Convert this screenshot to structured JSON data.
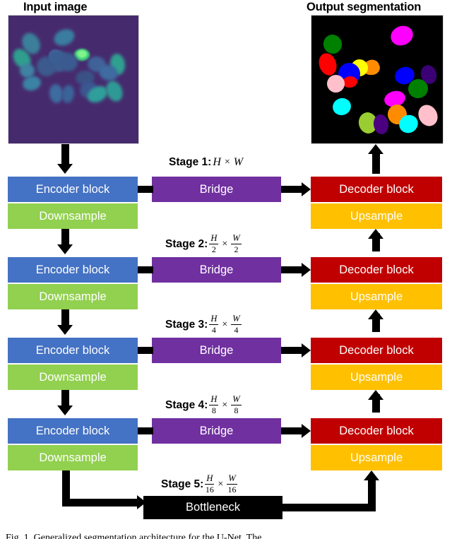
{
  "figure": {
    "panels": {
      "input": {
        "title": "Input image",
        "kind": "fluorescence-microscopy-nuclei"
      },
      "output": {
        "title": "Output segmentation",
        "kind": "instance-segmentation-mask"
      }
    },
    "caption": "Fig. 1. Generalized segmentation architecture for the U-Net. The",
    "colors": {
      "encoder": "#4472C4",
      "downsample": "#92D050",
      "bridge": "#7030A0",
      "decoder": "#C00000",
      "upsample": "#FFC000",
      "bottleneck": "#000000",
      "arrow": "#000000",
      "input_background": "#462A6E",
      "output_background": "#000000"
    },
    "labels": {
      "encoder": "Encoder block",
      "downsample": "Downsample",
      "bridge": "Bridge",
      "decoder": "Decoder block",
      "upsample": "Upsample",
      "bottleneck": "Bottleneck"
    },
    "stages": [
      {
        "name": "Stage 1:",
        "height_num": "H",
        "height_den": "",
        "width_num": "W",
        "width_den": "",
        "resolution": "H x W"
      },
      {
        "name": "Stage 2:",
        "height_num": "H",
        "height_den": "2",
        "width_num": "W",
        "width_den": "2",
        "resolution": "H/2 x W/2"
      },
      {
        "name": "Stage 3:",
        "height_num": "H",
        "height_den": "4",
        "width_num": "W",
        "width_den": "4",
        "resolution": "H/4 x W/4"
      },
      {
        "name": "Stage 4:",
        "height_num": "H",
        "height_den": "8",
        "width_num": "W",
        "width_den": "8",
        "resolution": "H/8 x W/8"
      },
      {
        "name": "Stage 5:",
        "height_num": "H",
        "height_den": "16",
        "width_num": "W",
        "width_den": "16",
        "resolution": "H/16 x W/16"
      }
    ],
    "times_symbol": "×"
  },
  "chart_data": {
    "type": "diagram",
    "title": "Generalized segmentation architecture for the U-Net",
    "nodes": [
      {
        "id": "input",
        "label": "Input image",
        "column": "left",
        "stage": 0,
        "color": "#462A6E"
      },
      {
        "id": "enc1",
        "label": "Encoder block",
        "column": "left",
        "stage": 1,
        "color": "#4472C4"
      },
      {
        "id": "down1",
        "label": "Downsample",
        "column": "left",
        "stage": 1,
        "color": "#92D050"
      },
      {
        "id": "enc2",
        "label": "Encoder block",
        "column": "left",
        "stage": 2,
        "color": "#4472C4"
      },
      {
        "id": "down2",
        "label": "Downsample",
        "column": "left",
        "stage": 2,
        "color": "#92D050"
      },
      {
        "id": "enc3",
        "label": "Encoder block",
        "column": "left",
        "stage": 3,
        "color": "#4472C4"
      },
      {
        "id": "down3",
        "label": "Downsample",
        "column": "left",
        "stage": 3,
        "color": "#92D050"
      },
      {
        "id": "enc4",
        "label": "Encoder block",
        "column": "left",
        "stage": 4,
        "color": "#4472C4"
      },
      {
        "id": "down4",
        "label": "Downsample",
        "column": "left",
        "stage": 4,
        "color": "#92D050"
      },
      {
        "id": "bridge1",
        "label": "Bridge",
        "column": "center",
        "stage": 1,
        "color": "#7030A0"
      },
      {
        "id": "bridge2",
        "label": "Bridge",
        "column": "center",
        "stage": 2,
        "color": "#7030A0"
      },
      {
        "id": "bridge3",
        "label": "Bridge",
        "column": "center",
        "stage": 3,
        "color": "#7030A0"
      },
      {
        "id": "bridge4",
        "label": "Bridge",
        "column": "center",
        "stage": 4,
        "color": "#7030A0"
      },
      {
        "id": "bottleneck",
        "label": "Bottleneck",
        "column": "center",
        "stage": 5,
        "color": "#000000"
      },
      {
        "id": "dec1",
        "label": "Decoder block",
        "column": "right",
        "stage": 1,
        "color": "#C00000"
      },
      {
        "id": "up1",
        "label": "Upsample",
        "column": "right",
        "stage": 1,
        "color": "#FFC000"
      },
      {
        "id": "dec2",
        "label": "Decoder block",
        "column": "right",
        "stage": 2,
        "color": "#C00000"
      },
      {
        "id": "up2",
        "label": "Upsample",
        "column": "right",
        "stage": 2,
        "color": "#FFC000"
      },
      {
        "id": "dec3",
        "label": "Decoder block",
        "column": "right",
        "stage": 3,
        "color": "#C00000"
      },
      {
        "id": "up3",
        "label": "Upsample",
        "column": "right",
        "stage": 3,
        "color": "#FFC000"
      },
      {
        "id": "dec4",
        "label": "Decoder block",
        "column": "right",
        "stage": 4,
        "color": "#C00000"
      },
      {
        "id": "up4",
        "label": "Upsample",
        "column": "right",
        "stage": 4,
        "color": "#FFC000"
      },
      {
        "id": "output",
        "label": "Output segmentation",
        "column": "right",
        "stage": 0,
        "color": "#000000"
      }
    ],
    "edges": [
      {
        "from": "input",
        "to": "enc1",
        "style": "arrow-down"
      },
      {
        "from": "down1",
        "to": "enc2",
        "style": "arrow-down"
      },
      {
        "from": "down2",
        "to": "enc3",
        "style": "arrow-down"
      },
      {
        "from": "down3",
        "to": "enc4",
        "style": "arrow-down"
      },
      {
        "from": "down4",
        "to": "bottleneck",
        "style": "elbow-down-right"
      },
      {
        "from": "enc1",
        "to": "bridge1",
        "style": "line-right"
      },
      {
        "from": "enc2",
        "to": "bridge2",
        "style": "line-right"
      },
      {
        "from": "enc3",
        "to": "bridge3",
        "style": "line-right"
      },
      {
        "from": "enc4",
        "to": "bridge4",
        "style": "line-right"
      },
      {
        "from": "bridge1",
        "to": "dec1",
        "style": "arrow-right"
      },
      {
        "from": "bridge2",
        "to": "dec2",
        "style": "arrow-right"
      },
      {
        "from": "bridge3",
        "to": "dec3",
        "style": "arrow-right"
      },
      {
        "from": "bridge4",
        "to": "dec4",
        "style": "arrow-right"
      },
      {
        "from": "bottleneck",
        "to": "up4",
        "style": "elbow-right-up"
      },
      {
        "from": "up4",
        "to": "dec3",
        "style": "arrow-up"
      },
      {
        "from": "up3",
        "to": "dec2",
        "style": "arrow-up"
      },
      {
        "from": "up2",
        "to": "dec1",
        "style": "arrow-up"
      },
      {
        "from": "up1",
        "to": "output",
        "style": "arrow-up"
      }
    ],
    "stage_resolutions": [
      "H x W",
      "H/2 x W/2",
      "H/4 x W/4",
      "H/8 x W/8",
      "H/16 x W/16"
    ]
  }
}
